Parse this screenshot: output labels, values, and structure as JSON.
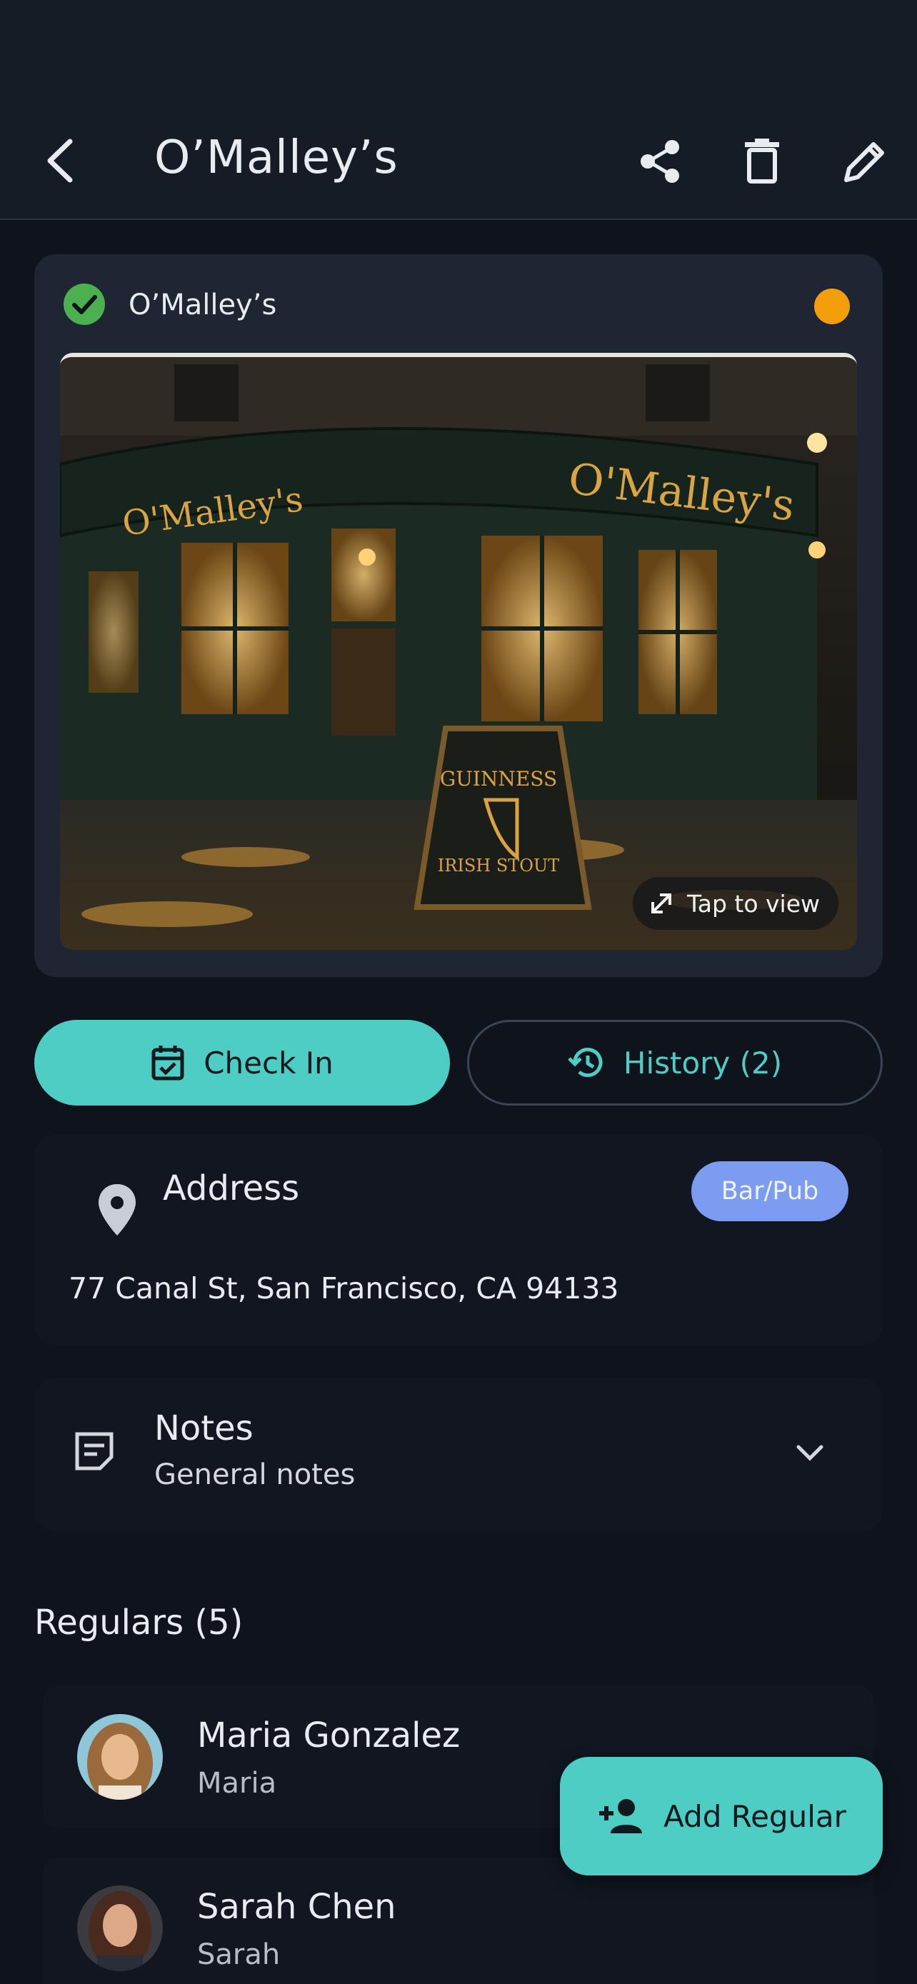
{
  "header": {
    "title": "O’Malley’s",
    "icons": [
      "back-arrow-icon",
      "share-icon",
      "delete-icon",
      "edit-icon"
    ]
  },
  "place": {
    "name": "O’Malley’s",
    "status_icon": "check-circle-icon",
    "status_dot_color": "#f59e0b",
    "photo": {
      "sign_left": "O'Malley's",
      "sign_right": "O'Malley's",
      "board_line1": "GUINNESS",
      "board_line2": "IRISH STOUT",
      "tap_label": "Tap to view"
    }
  },
  "actions": {
    "check_in": "Check In",
    "history": "History (2)"
  },
  "address": {
    "label": "Address",
    "category": "Bar/Pub",
    "value": "77 Canal St, San Francisco, CA 94133"
  },
  "notes": {
    "title": "Notes",
    "subtitle": "General notes"
  },
  "regulars": {
    "heading": "Regulars (5)",
    "items": [
      {
        "name": "Maria Gonzalez",
        "nickname": "Maria"
      },
      {
        "name": "Sarah Chen",
        "nickname": "Sarah"
      }
    ],
    "add_label": "Add Regular"
  },
  "colors": {
    "accent": "#4ecdc4",
    "badge": "#7b9cf0",
    "background": "#0f131b",
    "card": "#1e2533"
  }
}
